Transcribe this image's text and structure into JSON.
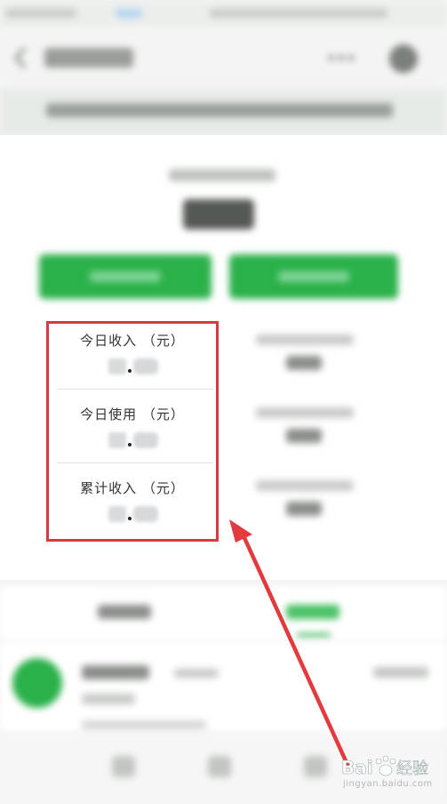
{
  "stats": [
    {
      "label": "今日收入 （元）"
    },
    {
      "label": "今日使用 （元）"
    },
    {
      "label": "累计收入 （元）"
    }
  ],
  "colors": {
    "accent": "#2bb14a",
    "highlight": "#d93a3f",
    "arrow": "#e23a3d"
  },
  "icons": {
    "back": "chevron-left-icon",
    "more": "more-icon",
    "settings": "settings-icon",
    "arrow": "annotation-arrow-icon"
  },
  "watermark": {
    "brand": "Bai",
    "brand_cn": "经验",
    "url": "jingyan.baidu.com"
  }
}
